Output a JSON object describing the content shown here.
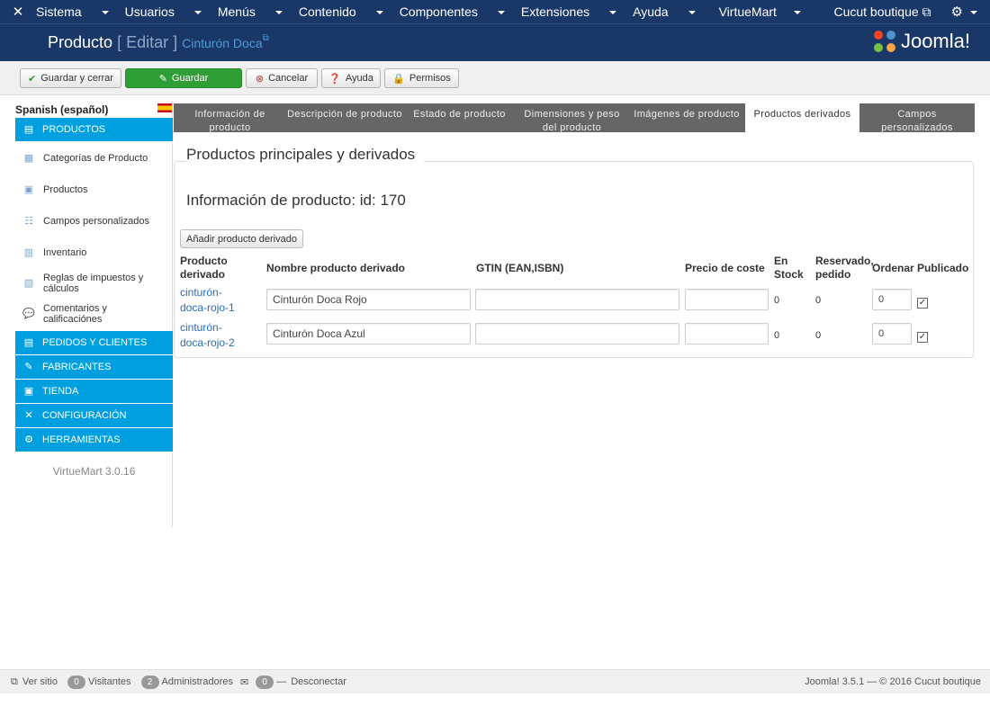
{
  "topnav": {
    "menu": [
      "Sistema",
      "Usuarios",
      "Menús",
      "Contenido",
      "Componentes",
      "Extensiones",
      "Ayuda",
      "VirtueMart"
    ],
    "site_link": "Cucut boutique"
  },
  "header": {
    "title": "Producto",
    "edit": "[ Editar ]",
    "product_name": "Cinturón Doca",
    "brand": "Joomla!"
  },
  "toolbar": {
    "save_close": "Guardar y cerrar",
    "save": "Guardar",
    "cancel": "Cancelar",
    "help": "Ayuda",
    "permissions": "Permisos"
  },
  "sidebar": {
    "language": "Spanish (español)",
    "products_header": "PRODUCTOS",
    "items": [
      "Categorías de Producto",
      "Productos",
      "Campos personalizados",
      "Inventario",
      "Reglas de impuestos y cálculos",
      "Comentarios y calificaciónes"
    ],
    "sections": [
      "PEDIDOS Y CLIENTES",
      "FABRICANTES",
      "TIENDA",
      "CONFIGURACIÓN",
      "HERRAMIENTAS"
    ],
    "version": "VirtueMart 3.0.16"
  },
  "tabs": [
    "Información de producto",
    "Descripción de producto",
    "Estado de producto",
    "Dimensiones y peso del producto",
    "Imágenes de producto",
    "Productos derivados",
    "Campos personalizados"
  ],
  "content": {
    "section_title": "Productos principales y derivados",
    "info": "Información de producto: id: 170",
    "add_button": "Añadir producto derivado",
    "columns": [
      "Producto derivado",
      "Nombre producto derivado",
      "GTIN (EAN,ISBN)",
      "Precio de coste",
      "En Stock",
      "Reservado, pedido",
      "Ordenar",
      "Publicado"
    ],
    "rows": [
      {
        "sku": "cinturón-doca-rojo-1",
        "name": "Cinturón Doca Rojo",
        "gtin": "",
        "price": "",
        "stock": "0",
        "reserved": "0",
        "order": "0",
        "published": true
      },
      {
        "sku": "cinturón-doca-rojo-2",
        "name": "Cinturón Doca Azul",
        "gtin": "",
        "price": "",
        "stock": "0",
        "reserved": "0",
        "order": "0",
        "published": true
      }
    ]
  },
  "footer": {
    "view_site": "Ver sitio",
    "visitors_count": "0",
    "visitors": "Visitantes",
    "admins_count": "2",
    "admins": "Administradores",
    "messages_count": "0",
    "logout": "Desconectar",
    "copyright": "Joomla! 3.5.1 — © 2016 Cucut boutique"
  },
  "colors": {
    "navbar": "#1a3867",
    "sidebar_accent": "#00a0e0",
    "save_green": "#2f9e35",
    "tab_gray": "#666666",
    "link": "#2a6ab3"
  }
}
